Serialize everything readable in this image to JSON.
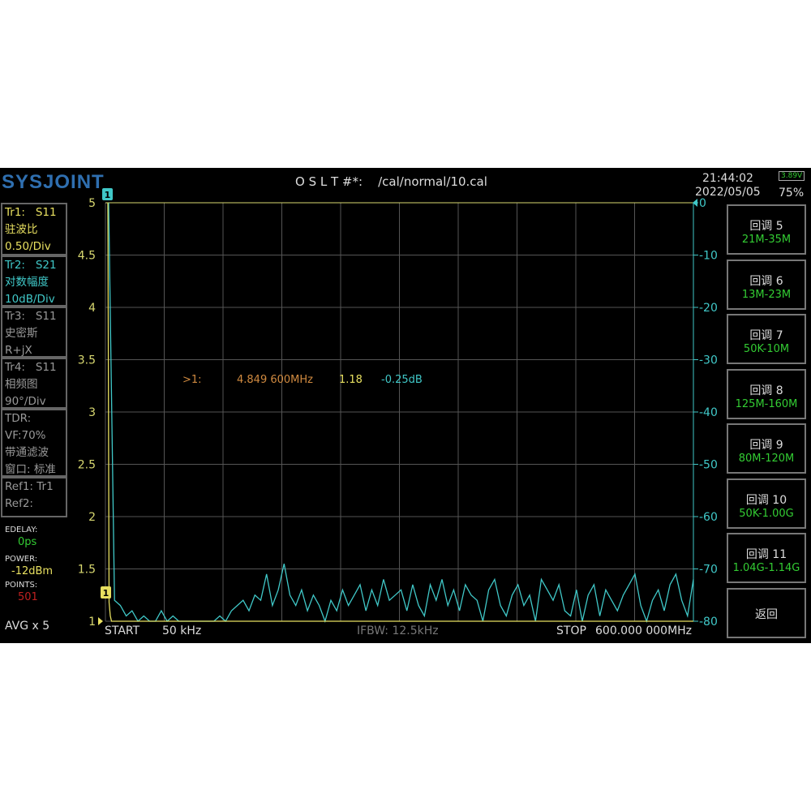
{
  "header": {
    "logo": "SYSJOINT",
    "cal_label": "O S L T #*:",
    "cal_file": "/cal/normal/10.cal",
    "time": "21:44:02",
    "date": "2022/05/05",
    "battery_voltage": "3.89V",
    "battery_percent": "75%"
  },
  "traces": [
    {
      "id": "Tr1:",
      "param": "S11",
      "format": "驻波比",
      "scale": "0.50/Div",
      "color": "#e8e060"
    },
    {
      "id": "Tr2:",
      "param": "S21",
      "format": "对数幅度",
      "scale": "10dB/Div",
      "color": "#40c8c8"
    },
    {
      "id": "Tr3:",
      "param": "S11",
      "format": "史密斯",
      "scale": "R+jX",
      "color": "#999999"
    },
    {
      "id": "Tr4:",
      "param": "S11",
      "format": "相频图",
      "scale": "90°/Div",
      "color": "#999999"
    }
  ],
  "tdr": {
    "label": "TDR:",
    "vf": "VF:70%",
    "mode": "带通滤波",
    "window": "窗口: 标准"
  },
  "refs": {
    "ref1": "Ref1:  Tr1",
    "ref2": "Ref2:"
  },
  "settings": {
    "edelay_label": "EDELAY:",
    "edelay": "0ps",
    "power_label": "POWER:",
    "power": "-12dBm",
    "points_label": "POINTS:",
    "points": "501",
    "avg": "AVG x 5"
  },
  "marker": {
    "label": ">1:",
    "freq": "4.849 600MHz",
    "swr": "1.18",
    "db": "-0.25dB",
    "tag": "1"
  },
  "footer": {
    "start_label": "START",
    "start": "50 kHz",
    "ifbw": "IFBW: 12.5kHz",
    "stop_label": "STOP",
    "stop": "600.000 000MHz"
  },
  "softkeys": [
    {
      "label": "回调 5",
      "range": "21M-35M"
    },
    {
      "label": "回调 6",
      "range": "13M-23M"
    },
    {
      "label": "回调 7",
      "range": "50K-10M"
    },
    {
      "label": "回调 8",
      "range": "125M-160M"
    },
    {
      "label": "回调 9",
      "range": "80M-120M"
    },
    {
      "label": "回调 10",
      "range": "50K-1.00G"
    },
    {
      "label": "回调 11",
      "range": "1.04G-1.14G"
    },
    {
      "label": "返回",
      "range": ""
    }
  ],
  "chart_data": {
    "type": "line",
    "x_range_mhz": [
      0.05,
      600
    ],
    "left_axis": {
      "ticks": [
        "5",
        "4.5",
        "4",
        "3.5",
        "3",
        "2.5",
        "2",
        "1.5",
        "1"
      ],
      "ylim": [
        1,
        5
      ]
    },
    "right_axis": {
      "ticks": [
        "0",
        "-10",
        "-20",
        "-30",
        "-40",
        "-50",
        "-60",
        "-70",
        "-80"
      ],
      "ylim": [
        -80,
        0
      ]
    },
    "series": [
      {
        "name": "Tr1 S11 SWR",
        "axis": "left",
        "values": [
          5,
          1.18,
          1.05,
          1,
          1,
          1,
          1,
          1,
          1,
          1,
          1
        ]
      },
      {
        "name": "Tr2 S21 dB",
        "axis": "right",
        "values": [
          0,
          -76,
          -77,
          -79,
          -78,
          -80,
          -79,
          -80,
          -80,
          -78,
          -80,
          -79,
          -80,
          -80,
          -80,
          -80,
          -80,
          -80,
          -80,
          -79,
          -80,
          -78,
          -77,
          -76,
          -78,
          -75,
          -76,
          -71,
          -77,
          -74,
          -69,
          -75,
          -77,
          -74,
          -78,
          -75,
          -77,
          -80,
          -76,
          -78,
          -74,
          -77,
          -75,
          -73,
          -78,
          -74,
          -77,
          -72,
          -76,
          -75,
          -74,
          -78,
          -73,
          -77,
          -79,
          -73,
          -76,
          -72,
          -77,
          -74,
          -78,
          -73,
          -75,
          -76,
          -80,
          -74,
          -72,
          -77,
          -79,
          -75,
          -73,
          -77,
          -75,
          -80,
          -72,
          -74,
          -76,
          -73,
          -78,
          -79,
          -74,
          -80,
          -75,
          -73,
          -79,
          -74,
          -76,
          -78,
          -75,
          -73,
          -71,
          -77,
          -80,
          -76,
          -74,
          -78,
          -73,
          -71,
          -76,
          -79,
          -72
        ]
      }
    ]
  }
}
